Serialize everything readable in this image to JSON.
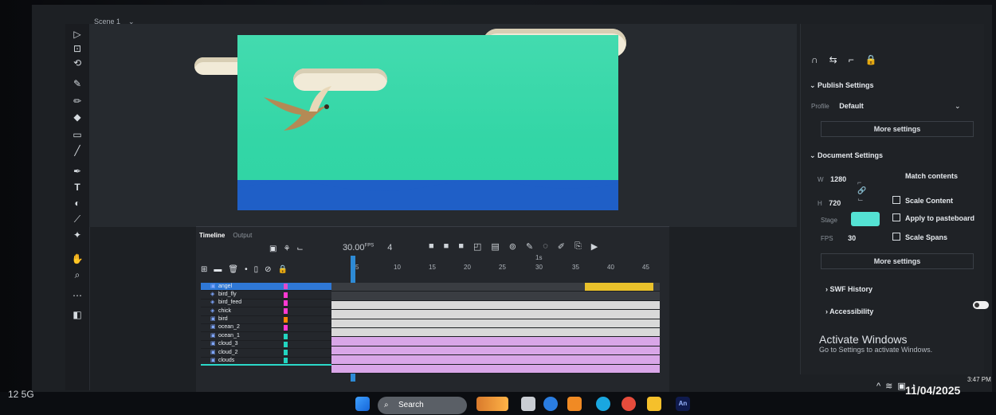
{
  "scene": {
    "name": "Scene 1"
  },
  "timeline": {
    "tab_active": "Timeline",
    "tab_other": "Output",
    "fps": "30.00",
    "fps_unit": "FPS",
    "frame_indicator": "4",
    "ruler": [
      "5",
      "10",
      "15",
      "20",
      "25",
      "30",
      "35",
      "40",
      "45"
    ],
    "ruler_secondary": "1s",
    "layers": [
      {
        "name": "angel",
        "selected": true,
        "color": "#e24aca"
      },
      {
        "name": "bird_fly",
        "selected": false,
        "color": "#ff39d2"
      },
      {
        "name": "bird_feed",
        "selected": false,
        "color": "#ff39d2"
      },
      {
        "name": "chick",
        "selected": false,
        "color": "#ff39d2"
      },
      {
        "name": "bird",
        "selected": false,
        "color": "#ff8a00"
      },
      {
        "name": "ocean_2",
        "selected": false,
        "color": "#ff39d2"
      },
      {
        "name": "ocean_1",
        "selected": false,
        "color": "#22d4c0"
      },
      {
        "name": "cloud_3",
        "selected": false,
        "color": "#22d4c0"
      },
      {
        "name": "cloud_2",
        "selected": false,
        "color": "#22d4c0"
      },
      {
        "name": "clouds",
        "selected": false,
        "color": "#22d4c0"
      }
    ]
  },
  "properties": {
    "publish_settings_label": "Publish Settings",
    "profile_label": "Profile",
    "profile_value": "Default",
    "more_settings_1": "More settings",
    "document_settings_label": "Document Settings",
    "w_label": "W",
    "w_value": "1280",
    "h_label": "H",
    "h_value": "720",
    "match_contents": "Match contents",
    "scale_content": "Scale Content",
    "stage_label": "Stage",
    "stage_color": "#54e2d3",
    "apply_to_pasteboard": "Apply to pasteboard",
    "fps_label": "FPS",
    "fps_value": "30",
    "scale_spans": "Scale Spans",
    "more_settings_2": "More settings",
    "swf_history": "SWF History",
    "accessibility": "Accessibility"
  },
  "activation": {
    "title": "Activate Windows",
    "subtitle": "Go to Settings to activate Windows."
  },
  "taskbar": {
    "search_label": "Search",
    "signal": "12 5G",
    "time": "3:47 PM",
    "date": "11/04/2025",
    "app_label": "An"
  }
}
